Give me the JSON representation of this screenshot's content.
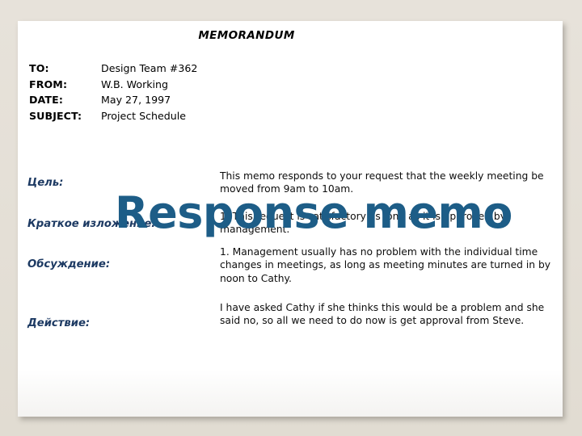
{
  "slide": {
    "overlay_title": "Response memo",
    "background_color": "#e4dfd6",
    "overlay_color": "#1d5d87",
    "label_color": "#1d3a63"
  },
  "memo": {
    "title": "MEMORANDUM",
    "fields": [
      {
        "label": "TO:",
        "value": "Design Team #362"
      },
      {
        "label": "FROM:",
        "value": "W.B. Working"
      },
      {
        "label": "DATE:",
        "value": "May 27, 1997"
      },
      {
        "label": "SUBJECT:",
        "value": "Project Schedule"
      }
    ],
    "sections": [
      {
        "label": "Цель:",
        "text": "This memo responds to your request that the weekly meeting be moved from 9am to 10am."
      },
      {
        "label": "Краткое изложение:",
        "text": "1. This request is satisfactory as long as it is approved by management."
      },
      {
        "label": "Обсуждение:",
        "text": "1. Management usually has no problem with the individual time changes in meetings, as long as meeting minutes are turned in by noon to Cathy."
      },
      {
        "label": "Действие:",
        "text": "I have asked Cathy if she thinks this would be a problem and she said no, so all we need to do now is get approval from Steve."
      }
    ]
  }
}
